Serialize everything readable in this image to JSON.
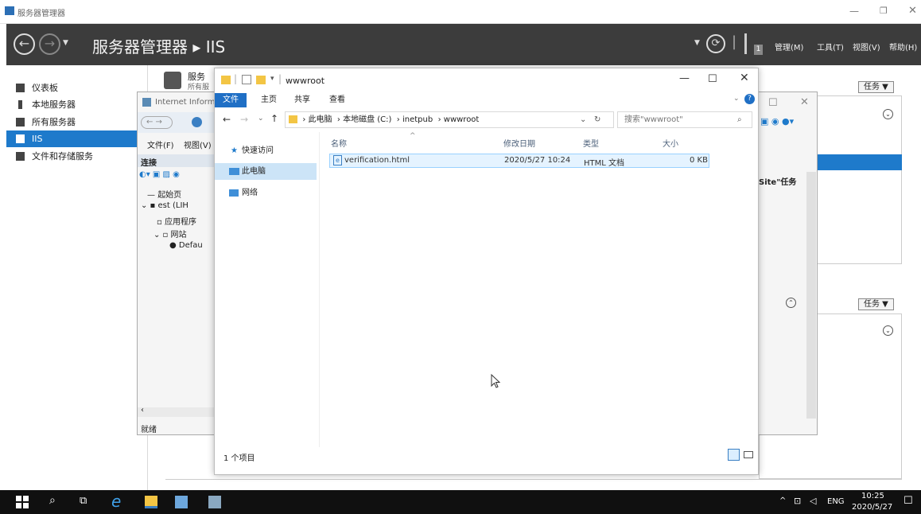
{
  "sm": {
    "window_title": "服务器管理器",
    "breadcrumb": "服务器管理器 ▸ IIS",
    "menus": [
      "管理(M)",
      "工具(T)",
      "视图(V)",
      "帮助(H)"
    ],
    "flag_count": "1",
    "sidebar": [
      {
        "label": "仪表板"
      },
      {
        "label": "本地服务器"
      },
      {
        "label": "所有服务器"
      },
      {
        "label": "IIS"
      },
      {
        "label": "文件和存储服务"
      }
    ],
    "task_label": "任务",
    "partial_tile_text": "服务",
    "partial_tile_text2": "所有服"
  },
  "iis": {
    "title": "Internet Inform",
    "menu_file": "文件(F)",
    "menu_view": "视图(V)",
    "connections": "连接",
    "tree": [
      "起始页",
      "est (LIH",
      "应用程序",
      "网站",
      "Defau"
    ],
    "status": "就绪",
    "right_header": "Site\"任务"
  },
  "explorer": {
    "title": "wwwroot",
    "ribbon_tabs": [
      "文件",
      "主页",
      "共享",
      "查看"
    ],
    "path": [
      "此电脑",
      "本地磁盘 (C:)",
      "inetpub",
      "wwwroot"
    ],
    "search_placeholder": "搜索\"wwwroot\"",
    "nav": [
      "快速访问",
      "此电脑",
      "网络"
    ],
    "columns": {
      "name": "名称",
      "date": "修改日期",
      "type": "类型",
      "size": "大小"
    },
    "files": [
      {
        "name": "verification.html",
        "date": "2020/5/27 10:24",
        "type": "HTML 文档",
        "size": "0 KB"
      }
    ],
    "status": "1 个项目"
  },
  "taskbar": {
    "lang": "ENG",
    "time": "10:25",
    "date": "2020/5/27"
  },
  "colors": {
    "accent": "#1e7acb",
    "header": "#3c3c3c",
    "taskbar": "#101010"
  }
}
